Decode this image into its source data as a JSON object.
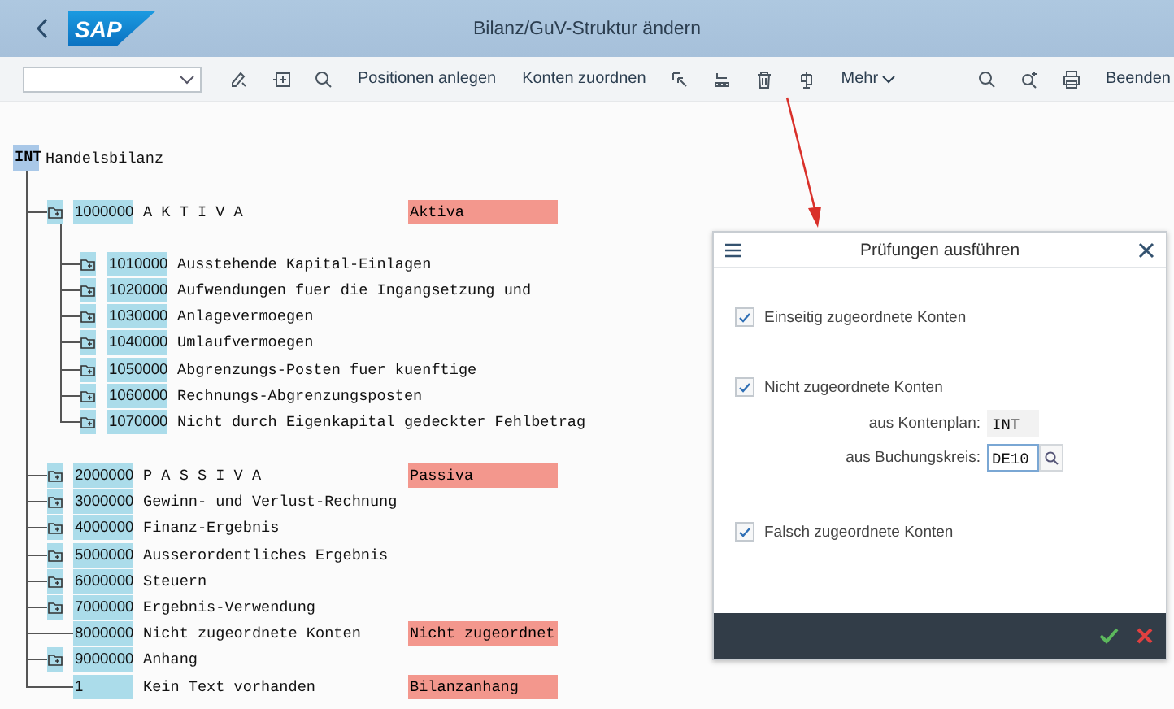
{
  "header": {
    "logo": "SAP",
    "title": "Bilanz/GuV-Struktur ändern"
  },
  "toolbar": {
    "buttons": [
      "Positionen anlegen",
      "Konten zuordnen"
    ],
    "menu": "Mehr",
    "exit": "Beenden"
  },
  "tree": {
    "code": "INT",
    "name": "Handelsbilanz",
    "children": [
      {
        "kind": "folder",
        "number": "1000000",
        "text": "A K T I V A",
        "tag": "Aktiva",
        "children": [
          {
            "kind": "folder",
            "number": "1010000",
            "text": "Ausstehende Kapital-Einlagen"
          },
          {
            "kind": "folder",
            "number": "1020000",
            "text": "Aufwendungen fuer die Ingangsetzung und"
          },
          {
            "kind": "folder",
            "number": "1030000",
            "text": "Anlagevermoegen"
          },
          {
            "kind": "folder",
            "number": "1040000",
            "text": "Umlaufvermoegen"
          },
          {
            "kind": "folder",
            "number": "1050000",
            "text": "Abgrenzungs-Posten fuer kuenftige"
          },
          {
            "kind": "folder",
            "number": "1060000",
            "text": "Rechnungs-Abgrenzungsposten"
          },
          {
            "kind": "folder",
            "number": "1070000",
            "text": "Nicht durch Eigenkapital gedeckter Fehlbetrag"
          }
        ]
      },
      {
        "kind": "folder",
        "number": "2000000",
        "text": "P A S S I V A",
        "tag": "Passiva"
      },
      {
        "kind": "folder",
        "number": "3000000",
        "text": "Gewinn- und Verlust-Rechnung"
      },
      {
        "kind": "folder",
        "number": "4000000",
        "text": "Finanz-Ergebnis"
      },
      {
        "kind": "folder",
        "number": "5000000",
        "text": "Ausserordentliches Ergebnis"
      },
      {
        "kind": "folder",
        "number": "6000000",
        "text": "Steuern"
      },
      {
        "kind": "folder",
        "number": "7000000",
        "text": "Ergebnis-Verwendung"
      },
      {
        "kind": "leaf",
        "number": "8000000",
        "text": "Nicht zugeordnete Konten",
        "tag": "Nicht zugeordnet"
      },
      {
        "kind": "folder",
        "number": "9000000",
        "text": "Anhang"
      },
      {
        "kind": "leaf",
        "number": "1",
        "text": "Kein Text vorhanden",
        "tag": "Bilanzanhang"
      }
    ]
  },
  "dialog": {
    "title": "Prüfungen ausführen",
    "checks": [
      {
        "label": "Einseitig zugeordnete Konten",
        "checked": true
      },
      {
        "label": "Nicht zugeordnete Konten",
        "checked": true,
        "fields": [
          {
            "label": "aus Kontenplan:",
            "value": "INT",
            "kind": "display"
          },
          {
            "label": "aus Buchungskreis:",
            "value": "DE10",
            "kind": "input"
          }
        ]
      },
      {
        "label": "Falsch zugeordnete Konten",
        "checked": true
      }
    ]
  }
}
